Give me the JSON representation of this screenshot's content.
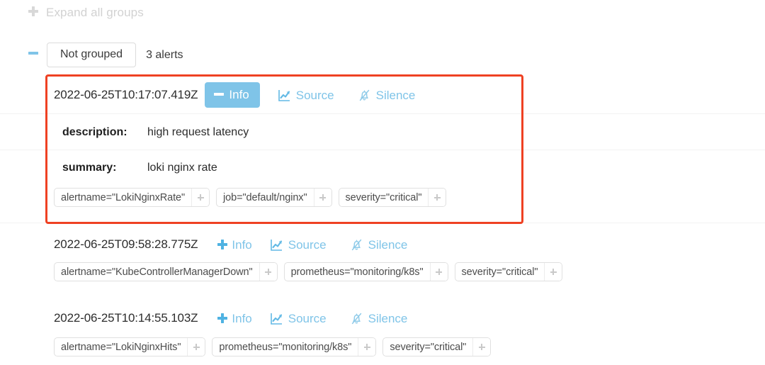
{
  "toolbar": {
    "expand_all_label": "Expand all groups",
    "expand_all_icon": "plus-icon"
  },
  "group": {
    "collapse_icon": "minus-icon",
    "button_label": "Not grouped",
    "count_label": "3 alerts"
  },
  "actions": {
    "info_label": "Info",
    "source_label": "Source",
    "silence_label": "Silence",
    "source_icon": "chart-line-icon",
    "silence_icon": "bell-slash-icon",
    "info_expanded_icon": "minus-icon",
    "info_collapsed_icon": "plus-icon"
  },
  "colors": {
    "accent_blue": "#7fc4e8",
    "highlight_red": "#ef4123",
    "chip_border": "#e0e0e0",
    "text_dark": "#2d2d2d",
    "muted_gray": "#d2d2d2"
  },
  "alerts": [
    {
      "timestamp": "2022-06-25T10:17:07.419Z",
      "expanded": true,
      "annotations": [
        {
          "key": "description:",
          "value": "high request latency"
        },
        {
          "key": "summary:",
          "value": "loki nginx rate"
        }
      ],
      "labels": [
        "alertname=\"LokiNginxRate\"",
        "job=\"default/nginx\"",
        "severity=\"critical\""
      ]
    },
    {
      "timestamp": "2022-06-25T09:58:28.775Z",
      "expanded": false,
      "annotations": [],
      "labels": [
        "alertname=\"KubeControllerManagerDown\"",
        "prometheus=\"monitoring/k8s\"",
        "severity=\"critical\""
      ]
    },
    {
      "timestamp": "2022-06-25T10:14:55.103Z",
      "expanded": false,
      "annotations": [],
      "labels": [
        "alertname=\"LokiNginxHits\"",
        "prometheus=\"monitoring/k8s\"",
        "severity=\"critical\""
      ]
    }
  ]
}
